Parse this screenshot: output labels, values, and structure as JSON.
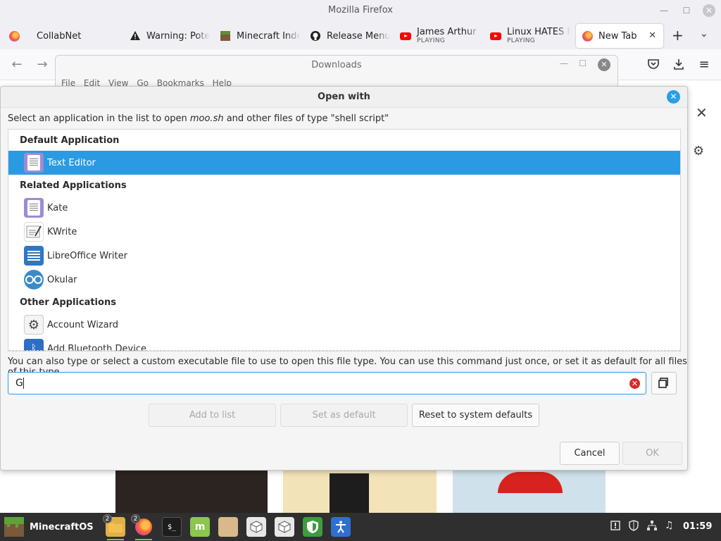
{
  "browser": {
    "window_title": "Mozilla Firefox",
    "tabs": [
      {
        "label": "CollabNet",
        "icon": "firefox-icon"
      },
      {
        "label": "Warning: Pote",
        "icon": "warning-icon"
      },
      {
        "label": "Minecraft Inde",
        "icon": "minecraft-icon"
      },
      {
        "label": "Release Menu",
        "icon": "github-icon"
      },
      {
        "label": "James Arthur",
        "sub": "PLAYING",
        "icon": "youtube-icon"
      },
      {
        "label": "Linux HATES M",
        "sub": "PLAYING",
        "icon": "youtube-icon"
      },
      {
        "label": "New Tab",
        "icon": "firefox-icon"
      }
    ]
  },
  "downloads_window": {
    "title": "Downloads",
    "menu": [
      "File",
      "Edit",
      "View",
      "Go",
      "Bookmarks",
      "Help"
    ]
  },
  "dialog": {
    "title": "Open with",
    "description_prefix": "Select an application in the list to open ",
    "description_file": "moo.sh",
    "description_suffix": " and other files of type \"shell script\"",
    "sections": {
      "default": "Default Application",
      "related": "Related Applications",
      "other": "Other Applications"
    },
    "default_apps": [
      {
        "label": "Text Editor",
        "icon": "text-editor-icon"
      }
    ],
    "related_apps": [
      {
        "label": "Kate",
        "icon": "kate-icon"
      },
      {
        "label": "KWrite",
        "icon": "kwrite-icon"
      },
      {
        "label": "LibreOffice Writer",
        "icon": "libreoffice-writer-icon"
      },
      {
        "label": "Okular",
        "icon": "okular-icon"
      }
    ],
    "other_apps": [
      {
        "label": "Account Wizard",
        "icon": "account-wizard-icon"
      },
      {
        "label": "Add Bluetooth Device",
        "icon": "bluetooth-icon"
      }
    ],
    "custom_label": "You can also type or select a custom executable file to use to open this file type.  You can use this command just once, or set it as default for all files of this type.",
    "command_value": "G",
    "buttons": {
      "add_to_list": "Add to list",
      "set_as_default": "Set as default",
      "reset": "Reset to system defaults",
      "cancel": "Cancel",
      "ok": "OK"
    }
  },
  "taskbar": {
    "menu_label": "MinecraftOS",
    "badges": [
      "2",
      "2"
    ],
    "clock": "01:59"
  },
  "colors": {
    "accent": "#2a9be3",
    "taskbar": "#2f2f2f"
  }
}
